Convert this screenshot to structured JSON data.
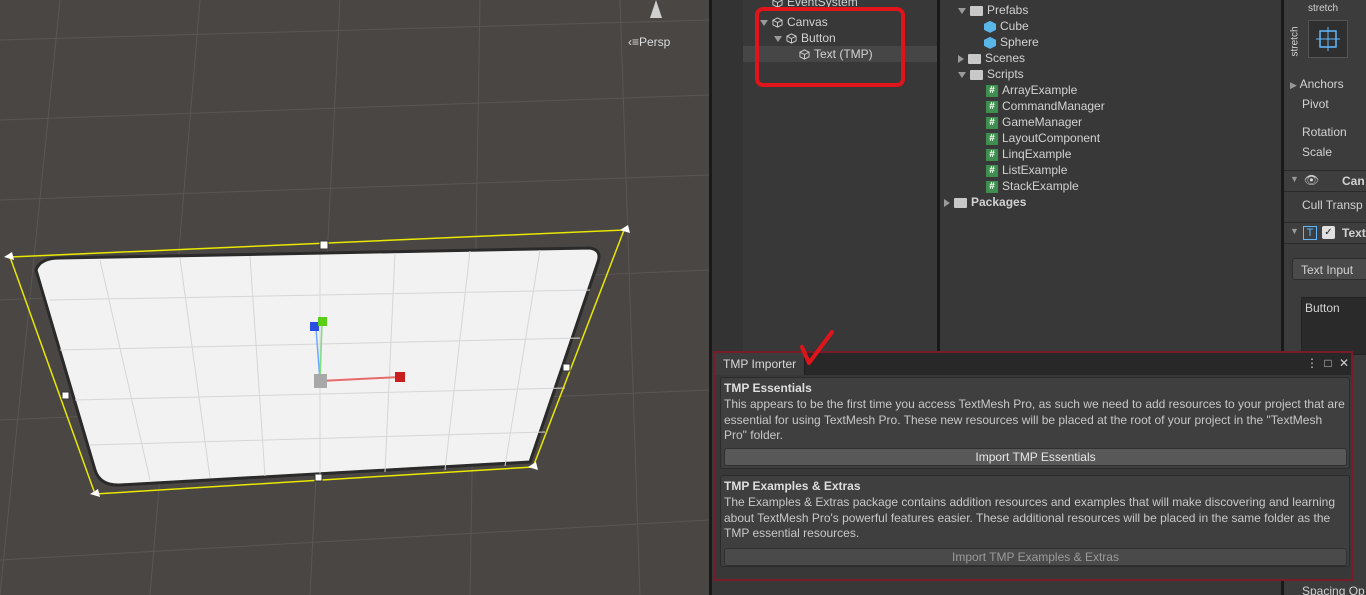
{
  "scene": {
    "persp_label": "Persp"
  },
  "hierarchy": {
    "items": [
      {
        "label": "EventSystem"
      },
      {
        "label": "Canvas"
      },
      {
        "label": "Button"
      },
      {
        "label": "Text (TMP)"
      }
    ]
  },
  "project": {
    "items": [
      {
        "label": "Prefabs"
      },
      {
        "label": "Cube"
      },
      {
        "label": "Sphere"
      },
      {
        "label": "Scenes"
      },
      {
        "label": "Scripts"
      },
      {
        "label": "ArrayExample"
      },
      {
        "label": "CommandManager"
      },
      {
        "label": "GameManager"
      },
      {
        "label": "LayoutComponent"
      },
      {
        "label": "LinqExample"
      },
      {
        "label": "ListExample"
      },
      {
        "label": "StackExample"
      },
      {
        "label": "Packages"
      }
    ]
  },
  "inspector": {
    "stretch_top": "stretch",
    "stretch_side": "stretch",
    "anchors": "Anchors",
    "pivot": "Pivot",
    "rotation": "Rotation",
    "scale": "Scale",
    "canvas_renderer": "Can",
    "cull_transparent": "Cull Transp",
    "textmesh": "Text",
    "text_input": "Text Input",
    "text_value": "Button",
    "spacing": "Spacing Op"
  },
  "tmp_importer": {
    "tab_label": "TMP Importer",
    "essentials_title": "TMP Essentials",
    "essentials_desc": "This appears to be the first time you access TextMesh Pro, as such we need to add resources to your project that are essential for using TextMesh Pro. These new resources will be placed at the root of your project in the \"TextMesh Pro\" folder.",
    "essentials_button": "Import TMP Essentials",
    "extras_title": "TMP Examples & Extras",
    "extras_desc": "The Examples & Extras package contains addition resources and examples that will make discovering and learning about TextMesh Pro's powerful features easier. These additional resources will be placed in the same folder as the TMP essential resources.",
    "extras_button": "Import TMP Examples & Extras"
  },
  "colors": {
    "annotation_red": "#e0141b",
    "selection_yellow": "#e8e800",
    "csharp_green": "#3e8f4e",
    "prefab_blue": "#5ab6e8"
  }
}
